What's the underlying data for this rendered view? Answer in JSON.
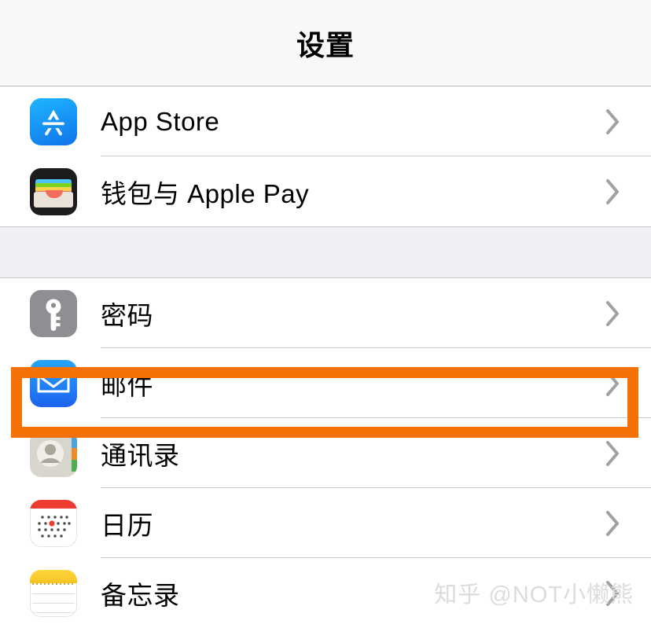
{
  "header": {
    "title": "设置"
  },
  "colors": {
    "highlight": "#f57105",
    "separator": "#c8c7cc",
    "group_gap": "#efeff4",
    "header_bg": "#f8f8f8",
    "chevron": "#a0a0a5",
    "watermark": "#dcdcdc"
  },
  "groups": [
    {
      "name": "store-group",
      "rows": [
        {
          "label": "App Store",
          "icon": "app-store-icon",
          "chevron": "chevron-right-icon",
          "highlighted": false
        },
        {
          "label": "钱包与 Apple Pay",
          "icon": "wallet-icon",
          "chevron": "chevron-right-icon",
          "highlighted": false
        }
      ]
    },
    {
      "name": "accounts-group",
      "rows": [
        {
          "label": "密码",
          "icon": "key-icon",
          "chevron": "chevron-right-icon",
          "highlighted": true
        },
        {
          "label": "邮件",
          "icon": "mail-icon",
          "chevron": "chevron-right-icon",
          "highlighted": false
        },
        {
          "label": "通讯录",
          "icon": "contacts-icon",
          "chevron": "chevron-right-icon",
          "highlighted": false
        },
        {
          "label": "日历",
          "icon": "calendar-icon",
          "chevron": "chevron-right-icon",
          "highlighted": false
        },
        {
          "label": "备忘录",
          "icon": "notes-icon",
          "chevron": "chevron-right-icon",
          "highlighted": false
        }
      ]
    }
  ],
  "watermark": {
    "text": "知乎 @NOT小懒熊"
  }
}
